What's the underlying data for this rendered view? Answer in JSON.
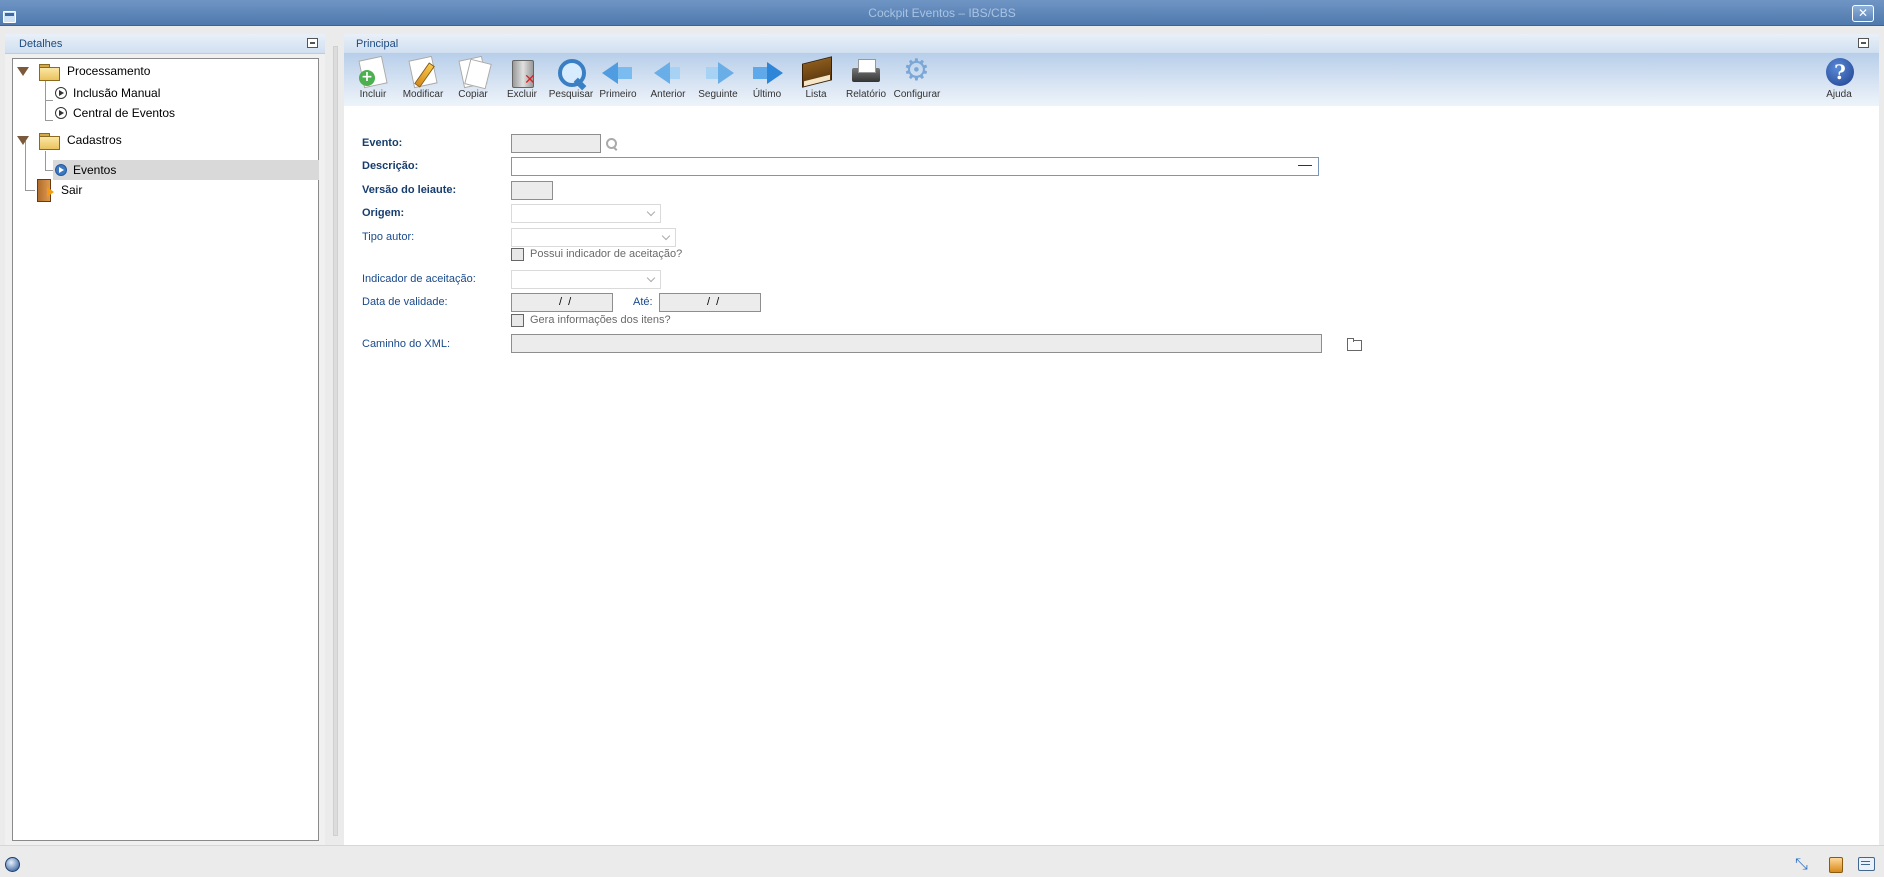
{
  "window": {
    "title": "Cockpit Eventos – IBS/CBS",
    "close_glyph": "✕"
  },
  "left_panel": {
    "title": "Detalhes",
    "tree": [
      {
        "label": "Processamento",
        "type": "folder"
      },
      {
        "label": "Inclusão Manual",
        "type": "action"
      },
      {
        "label": "Central de Eventos",
        "type": "action"
      },
      {
        "label": "Cadastros",
        "type": "folder"
      },
      {
        "label": "Eventos",
        "type": "action",
        "selected": true
      },
      {
        "label": "Sair",
        "type": "exit"
      }
    ]
  },
  "right_panel": {
    "title": "Principal",
    "toolbar": [
      {
        "label": "Incluir",
        "icon": "add-document-icon"
      },
      {
        "label": "Modificar",
        "icon": "edit-document-icon"
      },
      {
        "label": "Copiar",
        "icon": "copy-document-icon"
      },
      {
        "label": "Excluir",
        "icon": "trash-icon"
      },
      {
        "label": "Pesquisar",
        "icon": "magnifier-icon"
      },
      {
        "label": "Primeiro",
        "icon": "first-arrow-icon"
      },
      {
        "label": "Anterior",
        "icon": "previous-arrow-icon"
      },
      {
        "label": "Seguinte",
        "icon": "next-arrow-icon"
      },
      {
        "label": "Último",
        "icon": "last-arrow-icon"
      },
      {
        "label": "Lista",
        "icon": "book-icon"
      },
      {
        "label": "Relatório",
        "icon": "printer-icon"
      },
      {
        "label": "Configurar",
        "icon": "gear-icon"
      }
    ],
    "help": {
      "label": "Ajuda",
      "icon": "help-icon"
    },
    "form": {
      "evento_label": "Evento:",
      "evento_value": "",
      "descricao_label": "Descrição:",
      "descricao_value": "",
      "versao_label": "Versão do leiaute:",
      "versao_value": "",
      "origem_label": "Origem:",
      "origem_value": "",
      "tipo_autor_label": "Tipo autor:",
      "tipo_autor_value": "",
      "possui_indicador_label": "Possui indicador de aceitação?",
      "indicador_label": "Indicador de aceitação:",
      "indicador_value": "",
      "data_validade_label": "Data de validade:",
      "data_validade_value": "  /  /",
      "ate_label": "Até:",
      "ate_value": "  /  /",
      "gera_info_label": "Gera informações dos itens?",
      "caminho_xml_label": "Caminho do XML:",
      "caminho_xml_value": ""
    }
  },
  "colors": {
    "title_bar": "#4f79ad",
    "label_blue": "#1a4a8a",
    "selection": "#d9d9d9"
  }
}
